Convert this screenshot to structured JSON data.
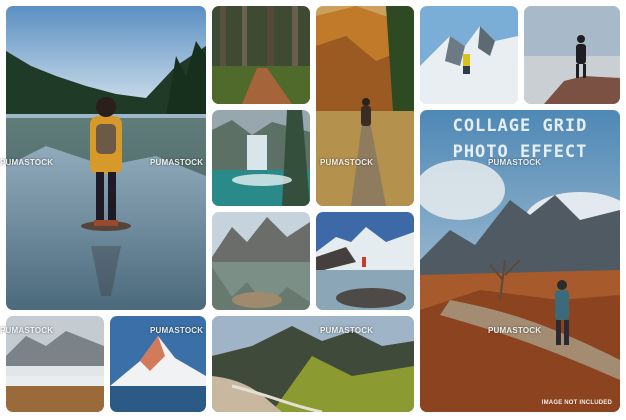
{
  "watermark": "PUMASTOCK",
  "headline": {
    "line1": "COLLAGE GRID",
    "line2": "PHOTO EFFECT"
  },
  "disclaimer": "IMAGE NOT INCLUDED",
  "colors": {
    "background": "#ffffff",
    "title_text": "#ffffff"
  },
  "photos": [
    {
      "subject": "hiker standing on rock in mountain lake"
    },
    {
      "subject": "forest trail"
    },
    {
      "subject": "autumn mountain hiker"
    },
    {
      "subject": "snowy summit hiker"
    },
    {
      "subject": "hiker on rocky peak at dusk"
    },
    {
      "subject": "frozen waterfall"
    },
    {
      "subject": "mountain lake reflection"
    },
    {
      "subject": "snowy peaks and lake"
    },
    {
      "subject": "patagonia trail featured"
    },
    {
      "subject": "misty mountains"
    },
    {
      "subject": "alpine sunset peak"
    },
    {
      "subject": "aerial valley river"
    }
  ]
}
